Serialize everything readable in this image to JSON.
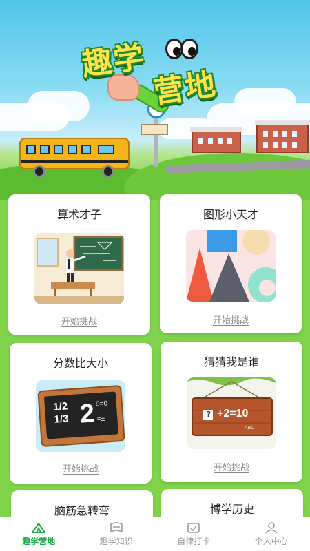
{
  "hero": {
    "title_line1": "趣学",
    "title_line2": "营地"
  },
  "cards": [
    {
      "title": "算术才子",
      "action": "开始挑战",
      "image": "teacher-classroom"
    },
    {
      "title": "图形小天才",
      "action": "开始挑战",
      "image": "shapes"
    },
    {
      "title": "分数比大小",
      "action": "开始挑战",
      "image": "fraction-chalkboard",
      "board_line1": "1/2",
      "board_line2": "1/3",
      "board_big": "2",
      "board_small1": "9=0",
      "board_small2": "=±"
    },
    {
      "title": "猜猜我是谁",
      "action": "开始挑战",
      "image": "wooden-sign",
      "sign_text": "+2=10",
      "sign_box": "?",
      "sign_footer": "ABC"
    },
    {
      "title": "脑筋急转弯"
    },
    {
      "title": "博学历史"
    }
  ],
  "tabbar": {
    "items": [
      {
        "label": "趣学营地",
        "icon": "camp-icon",
        "active": true
      },
      {
        "label": "趣学知识",
        "icon": "book-icon",
        "active": false
      },
      {
        "label": "自律打卡",
        "icon": "calendar-check-icon",
        "active": false
      },
      {
        "label": "个人中心",
        "icon": "user-icon",
        "active": false
      }
    ]
  },
  "colors": {
    "accent": "#1ea84a",
    "background": "#7fd44a",
    "title_yellow": "#ffe24a"
  }
}
